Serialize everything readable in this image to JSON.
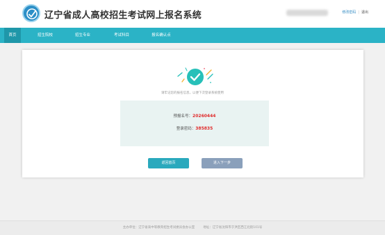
{
  "header": {
    "title": "辽宁省成人高校招生考试网上报名系统",
    "links": {
      "change_password": "修改密码",
      "logout": "退出"
    }
  },
  "nav": {
    "items": [
      {
        "label": "首页",
        "active": true
      },
      {
        "label": "招生院校",
        "active": false
      },
      {
        "label": "招生专业",
        "active": false
      },
      {
        "label": "考试科目",
        "active": false
      },
      {
        "label": "报名确认点",
        "active": false
      }
    ]
  },
  "result": {
    "icon": "success-check-icon",
    "hint": "请牢记您的报名信息，以便下次登录系统使用",
    "register_label": "预报名号：",
    "register_number": "20260444",
    "password_label": "登录密码：",
    "password_value": "385835"
  },
  "buttons": {
    "home": "返回首页",
    "next": "进入下一步"
  },
  "footer": {
    "organizer": "主办单位：辽宁省高中等教育招生考试委员会办公室",
    "address": "地址：辽宁省沈阳市于洪区西江北街101号"
  },
  "colors": {
    "nav_bg": "#2bb3c6",
    "nav_active": "#1f97a9",
    "accent": "#e02b2b",
    "success": "#27c0b9"
  }
}
